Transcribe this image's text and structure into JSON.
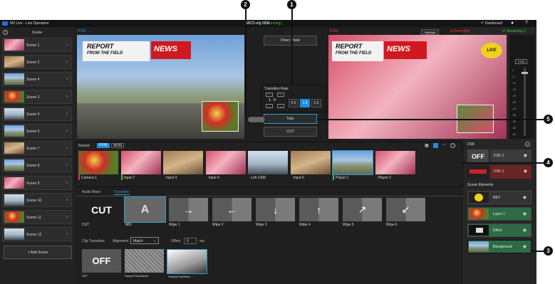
{
  "app": {
    "title": "M2 Live - Live Operation",
    "project": "ABCD-efg 0001",
    "status": "(Running)",
    "dashboard": "Dashboard"
  },
  "scenes": {
    "header": "Scene",
    "items": [
      "Scene 1",
      "Scene 2",
      "Scene 4",
      "Scene 3",
      "Scene 5",
      "Scene 6",
      "Scene 7",
      "Scene 8",
      "Scene 9",
      "Scene 10",
      "Scene 11",
      "Scene 12"
    ],
    "add": "+ Add Scene"
  },
  "pvw": {
    "label": "PVW",
    "banner1": "REPORT",
    "banner2": "FROM THE FIELD",
    "news": "NEWS"
  },
  "pgm": {
    "label": "PGM",
    "highlight": "Highlight",
    "recording": "Recording",
    "streaming": "Streaming 2",
    "live": "LIVE",
    "meter_label": "PGM",
    "meter_ticks": [
      "0",
      "-5",
      "-10",
      "-15",
      "-20",
      "-25",
      "-30",
      "-35",
      "-40",
      "-50",
      "-60"
    ]
  },
  "center": {
    "direct_mode": "Direct Mode",
    "transition_rate": "Transition Rate",
    "rate_value": "1 . 0",
    "rates": [
      "0.5",
      "1.0",
      "1.5"
    ],
    "take": "Take",
    "cut": "CUT"
  },
  "source_bar": {
    "label": "Source",
    "tabs": [
      "PVW",
      "MON"
    ]
  },
  "sources": [
    "Camera 1",
    "Input 2",
    "Input 3",
    "Input 4",
    "Left CAM",
    "Input 6",
    "Player 1",
    "Player 2"
  ],
  "bottom_tabs": [
    "Audio Mixer",
    "Transition"
  ],
  "transitions": {
    "items": [
      "CUT",
      "MIX",
      "Wipe 1",
      "Wipe 2",
      "Wipe 3",
      "Wipe 4",
      "Wipe 5",
      "Wipe 6"
    ],
    "cut_glyph": "CUT"
  },
  "clip_transition": {
    "label": "Clip Transition",
    "alignment_label": "Alignment",
    "alignment_value": "Match",
    "offset_label": "Offset",
    "offset_value": "0",
    "offset_unit": "sec",
    "items": [
      "OFF",
      "SampleTransition2",
      "SampleTransition"
    ],
    "off_glyph": "OFF"
  },
  "dsk": {
    "label": "DSK",
    "off": "OFF",
    "items": [
      "DSK 2",
      "DSK 1"
    ]
  },
  "scene_elements": {
    "label": "Scene Elements",
    "items": [
      "KEY",
      "Layer 1",
      "Effect",
      "Background"
    ]
  },
  "callouts": [
    "1",
    "2",
    "3",
    "4",
    "5"
  ]
}
